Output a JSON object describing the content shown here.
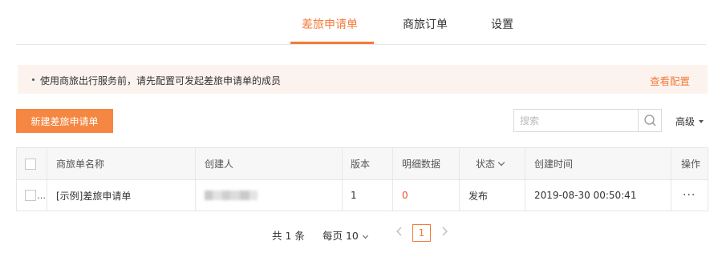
{
  "tabs": [
    {
      "label": "差旅申请单",
      "active": true
    },
    {
      "label": "商旅订单",
      "active": false
    },
    {
      "label": "设置",
      "active": false
    }
  ],
  "notice": {
    "text": "使用商旅出行服务前，请先配置可发起差旅申请单的成员",
    "link_label": "查看配置"
  },
  "toolbar": {
    "create_label": "新建差旅申请单",
    "search_placeholder": "搜索",
    "advanced_label": "高级"
  },
  "table": {
    "headers": {
      "name": "商旅单名称",
      "creator": "创建人",
      "version": "版本",
      "details": "明细数据",
      "status": "状态",
      "created_at": "创建时间",
      "actions": "操作"
    },
    "rows": [
      {
        "name": "[示例]差旅申请单",
        "creator": "",
        "version": "1",
        "details": "0",
        "status": "发布",
        "created_at": "2019-08-30 00:50:41",
        "actions": "···"
      }
    ]
  },
  "pagination": {
    "total_label": "共 1 条",
    "page_size_label": "每页 10",
    "current_page": "1"
  },
  "colors": {
    "accent": "#f37b3a",
    "button": "#f58742",
    "notice_bg": "#fdf3ee",
    "detail_number": "#e8542c"
  }
}
